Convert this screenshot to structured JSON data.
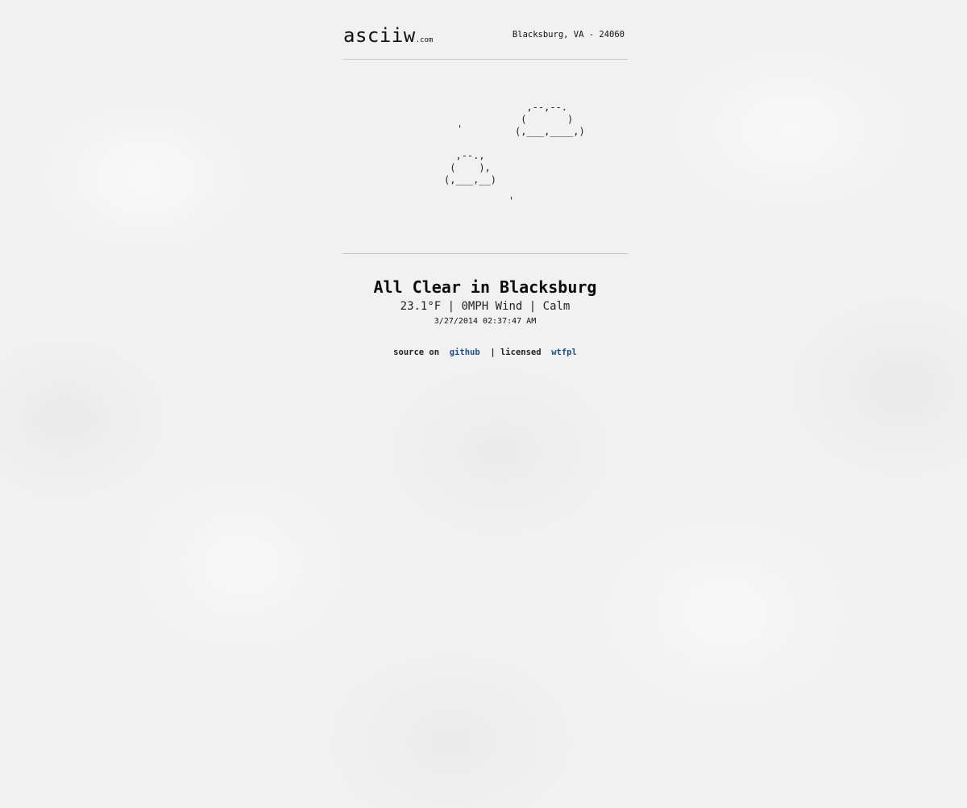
{
  "header": {
    "logo_main": "asciiw",
    "logo_tld": ".com",
    "location": "Blacksburg, VA - 24060"
  },
  "art": {
    "cloud_big": "  ,--,--.\n (       )\n(,___,____,)",
    "cloud_small": "  ,--.,\n (    ),\n(,___,__)",
    "drop1": "'",
    "drop2": "'"
  },
  "weather": {
    "title": "All Clear in Blacksburg",
    "conditions": "23.1°F | 0MPH Wind | Calm",
    "timestamp": "3/27/2014 02:37:47 AM"
  },
  "footer": {
    "source_prefix": "source on",
    "source_link": "github",
    "separator": "|",
    "license_prefix": "licensed",
    "license_link": "wtfpl"
  },
  "colors": {
    "link": "#1f4f86",
    "background": "#f1f1f1",
    "divider": "#c8c8c8"
  }
}
